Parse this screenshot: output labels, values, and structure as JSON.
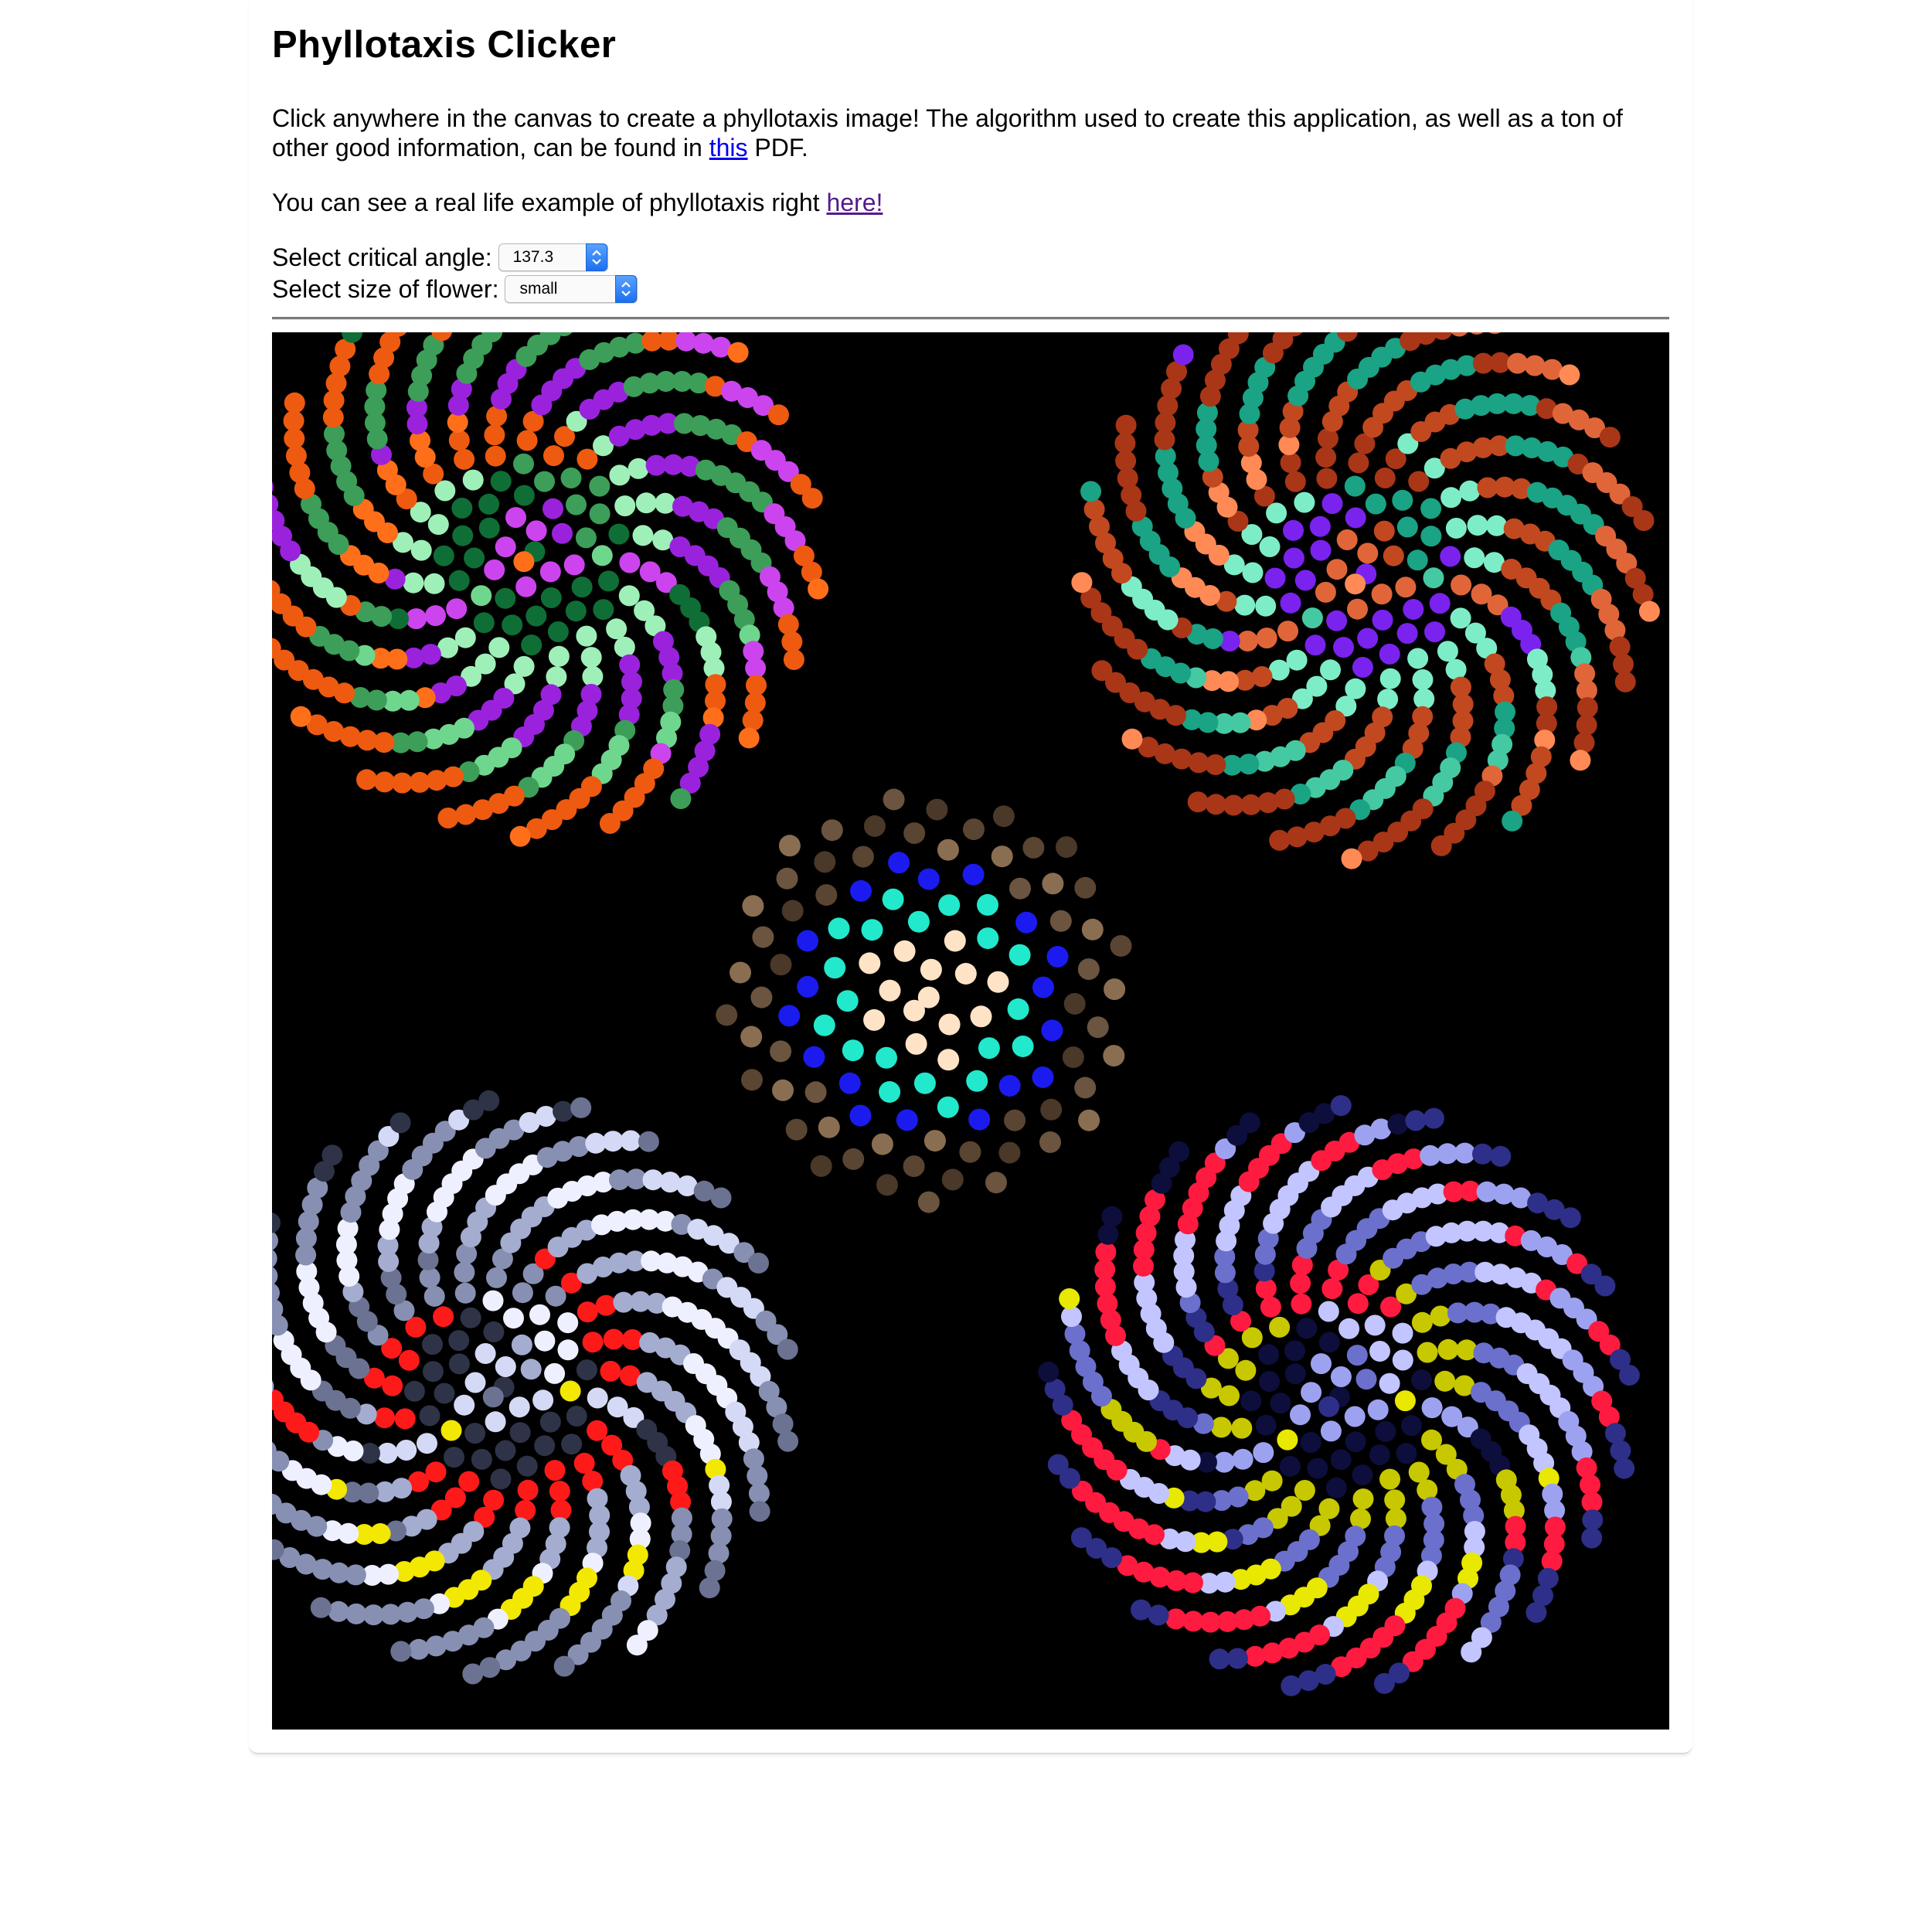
{
  "page": {
    "title": "Phyllotaxis Clicker",
    "intro_before_link": "Click anywhere in the canvas to create a phyllotaxis image! The algorithm used to create this application, as well as a ton of other good information, can be found in ",
    "intro_link": "this",
    "intro_after_link": " PDF.",
    "example_text": "You can see a real life example of phyllotaxis right ",
    "example_link": "here!"
  },
  "controls": {
    "angle_label": "Select critical angle:",
    "angle_value": "137.3",
    "size_label": "Select size of flower:",
    "size_value": "small"
  },
  "canvas": {
    "background": "#000000",
    "flowers": [
      {
        "name": "top-left",
        "angle": 137.3,
        "count": 380,
        "spacing": 19.1,
        "dot": 13.5,
        "center_in_view": [
          0.188,
          0.157
        ],
        "palette": [
          "#cc44ee",
          "#9a22dd",
          "#ff6f1a",
          "#0f6e35",
          "#3c9e58",
          "#6fd68e",
          "#9ff0b8",
          "#ee5a10"
        ]
      },
      {
        "name": "top-right",
        "angle": 137.3,
        "count": 380,
        "spacing": 19.1,
        "dot": 13.5,
        "center_in_view": [
          0.783,
          0.173
        ],
        "palette": [
          "#e0663a",
          "#c2481f",
          "#ff8a55",
          "#7a22ee",
          "#1aa384",
          "#45c9a3",
          "#7dedc7",
          "#a93617"
        ]
      },
      {
        "name": "center",
        "angle": 137.5,
        "count": 110,
        "spacing": 25.5,
        "dot": 14,
        "center_in_view": [
          0.47,
          0.476
        ],
        "palette": [
          "#ffe3c6",
          "#ffe3c6",
          "#22e8cc",
          "#1b1bf0",
          "#6b5440",
          "#8a6e52",
          "#5a4532",
          "#4a3828"
        ]
      },
      {
        "name": "bottom-left",
        "angle": 137.3,
        "count": 400,
        "spacing": 18.8,
        "dot": 13.5,
        "center_in_view": [
          0.166,
          0.755
        ],
        "palette": [
          "#d4daf5",
          "#a4acd0",
          "#6b7292",
          "#2e3348",
          "#eef0ff",
          "#f2e800",
          "#ff1a1a",
          "#8790b2"
        ]
      },
      {
        "name": "bottom-right",
        "angle": 137.3,
        "count": 420,
        "spacing": 18.6,
        "dot": 13.5,
        "center_in_view": [
          0.764,
          0.762
        ],
        "palette": [
          "#9da2f0",
          "#6b70cc",
          "#2d2f88",
          "#0d0e3c",
          "#c2c5ff",
          "#e8e800",
          "#c8c800",
          "#ff1a40"
        ]
      }
    ]
  }
}
